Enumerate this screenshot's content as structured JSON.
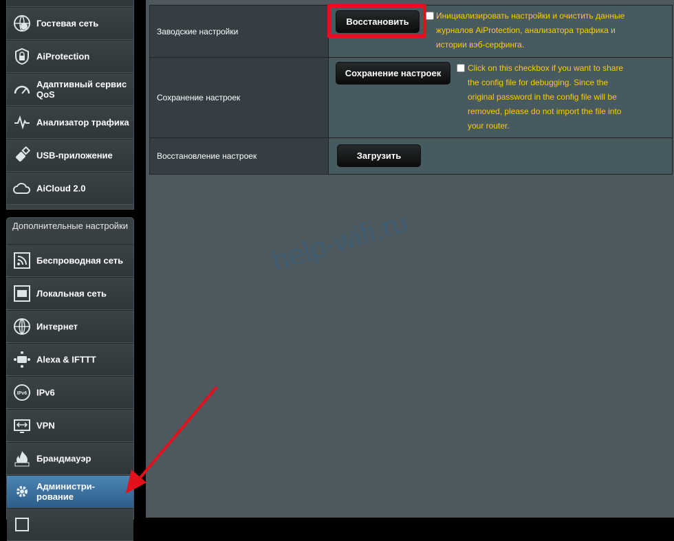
{
  "sidebar": {
    "top_items": [
      {
        "label": "Гостевая сеть",
        "icon": "guest-network-icon"
      },
      {
        "label": "AiProtection",
        "icon": "shield-lock-icon"
      },
      {
        "label": "Адаптивный сервис QoS",
        "icon": "speedometer-icon"
      },
      {
        "label": "Анализатор трафика",
        "icon": "traffic-analyzer-icon"
      },
      {
        "label": "USB-приложение",
        "icon": "usb-icon"
      },
      {
        "label": "AiCloud 2.0",
        "icon": "cloud-icon"
      }
    ],
    "advanced_header": "Дополнительные настройки",
    "advanced_items": [
      {
        "label": "Беспроводная сеть",
        "icon": "wireless-icon"
      },
      {
        "label": "Локальная сеть",
        "icon": "lan-icon"
      },
      {
        "label": "Интернет",
        "icon": "globe-icon"
      },
      {
        "label": "Alexa & IFTTT",
        "icon": "alexa-ifttt-icon"
      },
      {
        "label": "IPv6",
        "icon": "ipv6-icon"
      },
      {
        "label": "VPN",
        "icon": "vpn-icon"
      },
      {
        "label": "Брандмауэр",
        "icon": "firewall-icon"
      },
      {
        "label": "Администри-рование",
        "icon": "admin-gear-icon",
        "active": true
      }
    ]
  },
  "settings": {
    "factory": {
      "label": "Заводские настройки",
      "button": "Восстановить",
      "note": "Инициализировать настройки и очистить данные журналов AiProtection, анализатора трафика и истории вэб-серфинга."
    },
    "save": {
      "label": "Сохранение настроек",
      "button": "Сохранение настроек",
      "note": "Click on this checkbox if you want to share the config file for debugging. Since the original password in the config file will be removed, please do not import the file into your router."
    },
    "restore": {
      "label": "Восстановление настроек",
      "button": "Загрузить"
    }
  },
  "watermark": "help-wifi.ru",
  "colors": {
    "accent_active": "#4b84b3",
    "note_text": "#ffcc00",
    "highlight": "#e2111b",
    "arrow": "#e2111b"
  }
}
